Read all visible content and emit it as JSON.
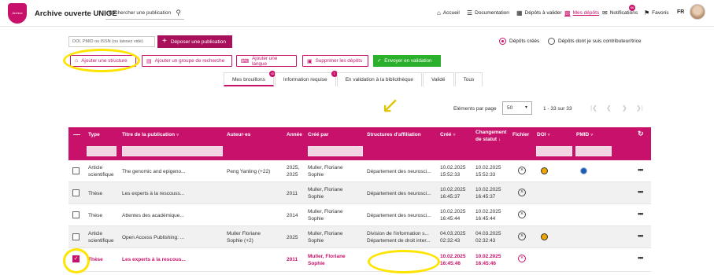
{
  "header": {
    "logo_text": "Archive ouverte",
    "app_title": "Archive ouverte UNIGE",
    "search_placeholder": "Rechercher une publication",
    "nav": [
      {
        "label": "Accueil",
        "icon": "home-icon"
      },
      {
        "label": "Documentation",
        "icon": "menu-icon"
      },
      {
        "label": "Dépôts à valider",
        "icon": "clipboard-icon"
      },
      {
        "label": "Mes dépôts",
        "icon": "folder-icon"
      },
      {
        "label": "Notifications",
        "icon": "mail-icon"
      },
      {
        "label": "Favoris",
        "icon": "bookmark-icon"
      }
    ],
    "notifications_count": "66",
    "language": "FR"
  },
  "toolbar": {
    "doi_placeholder": "DOI, PMID ou ISSN (ou laissez vide)",
    "deposit_label": "Déposer une publication",
    "radio_created": "Dépôts créés",
    "radio_contributor": "Dépôts dont je suis contributeur/trice",
    "buttons": [
      "Ajouter une structure",
      "Ajouter un groupe de recherche",
      "Ajouter une langue",
      "Supprimer les dépôts"
    ],
    "send_label": "Envoyer en validation"
  },
  "tabs": [
    {
      "label": "Mes brouillons",
      "count": "40",
      "active": true
    },
    {
      "label": "Information requise",
      "count": "2",
      "active": false
    },
    {
      "label": "En validation à la bibliothèque",
      "count": "",
      "active": false
    },
    {
      "label": "Validé",
      "count": "",
      "active": false
    },
    {
      "label": "Tous",
      "count": "",
      "active": false
    }
  ],
  "pager": {
    "label": "Eléments par page",
    "page_size": "50",
    "range": "1 - 33 sur 33"
  },
  "table": {
    "columns": {
      "type": "Type",
      "title": "Titre de la publication",
      "authors": "Auteur·es",
      "year": "Année",
      "created_by": "Créé par",
      "structures": "Structures d'affiliation",
      "created": "Créé",
      "status_change_1": "Changement",
      "status_change_2": "de statut",
      "file": "Fichier",
      "doi": "DOI",
      "pmid": "PMID"
    },
    "rows": [
      {
        "type1": "Article",
        "type2": "scientifique",
        "title": "The genomic and epigeno...",
        "authors1": "Peng Yanling (+22)",
        "authors2": "",
        "year1": "2025,",
        "year2": "2025",
        "by1": "Muller, Floriane",
        "by2": "Sophie",
        "struct1": "Département des neurosci...",
        "struct2": "",
        "created1": "10.02.2025",
        "created2": "15:52:33",
        "changed1": "10.02.2025",
        "changed2": "15:52:33",
        "doi": true,
        "pmid": true,
        "selected": false
      },
      {
        "type1": "Thèse",
        "type2": "",
        "title": "Les experts à la rescouss...",
        "authors1": "",
        "authors2": "",
        "year1": "2011",
        "year2": "",
        "by1": "Muller, Floriane",
        "by2": "Sophie",
        "struct1": "Département des neurosci...",
        "struct2": "",
        "created1": "10.02.2025",
        "created2": "16:45:37",
        "changed1": "10.02.2025",
        "changed2": "16:45:37",
        "doi": false,
        "pmid": false,
        "selected": false
      },
      {
        "type1": "Thèse",
        "type2": "",
        "title": "Attentes des académique...",
        "authors1": "",
        "authors2": "",
        "year1": "2014",
        "year2": "",
        "by1": "Muller, Floriane",
        "by2": "Sophie",
        "struct1": "Département des neurosci...",
        "struct2": "",
        "created1": "10.02.2025",
        "created2": "16:45:44",
        "changed1": "10.02.2025",
        "changed2": "16:45:44",
        "doi": false,
        "pmid": false,
        "selected": false
      },
      {
        "type1": "Article",
        "type2": "scientifique",
        "title": "Open Access Publishing: ...",
        "authors1": "Muller Floriane",
        "authors2": "Sophie (+2)",
        "year1": "2025",
        "year2": "",
        "by1": "Muller, Floriane",
        "by2": "Sophie",
        "struct1": "Division de l'information s...",
        "struct2": "Département de droit inter...",
        "created1": "04.03.2025",
        "created2": "02:32:43",
        "changed1": "04.03.2025",
        "changed2": "02:32:43",
        "doi": true,
        "pmid": false,
        "selected": false
      },
      {
        "type1": "Thèse",
        "type2": "",
        "title": "Les experts à la rescous...",
        "authors1": "",
        "authors2": "",
        "year1": "2011",
        "year2": "",
        "by1": "Muller, Floriane",
        "by2": "Sophie",
        "struct1": "",
        "struct2": "",
        "created1": "10.02.2025",
        "created2": "16:45:46",
        "changed1": "10.02.2025",
        "changed2": "16:45:46",
        "doi": false,
        "pmid": false,
        "selected": true
      }
    ]
  },
  "colors": {
    "accent": "#c8116b",
    "success": "#2bb02b",
    "highlight": "#ffe400"
  }
}
